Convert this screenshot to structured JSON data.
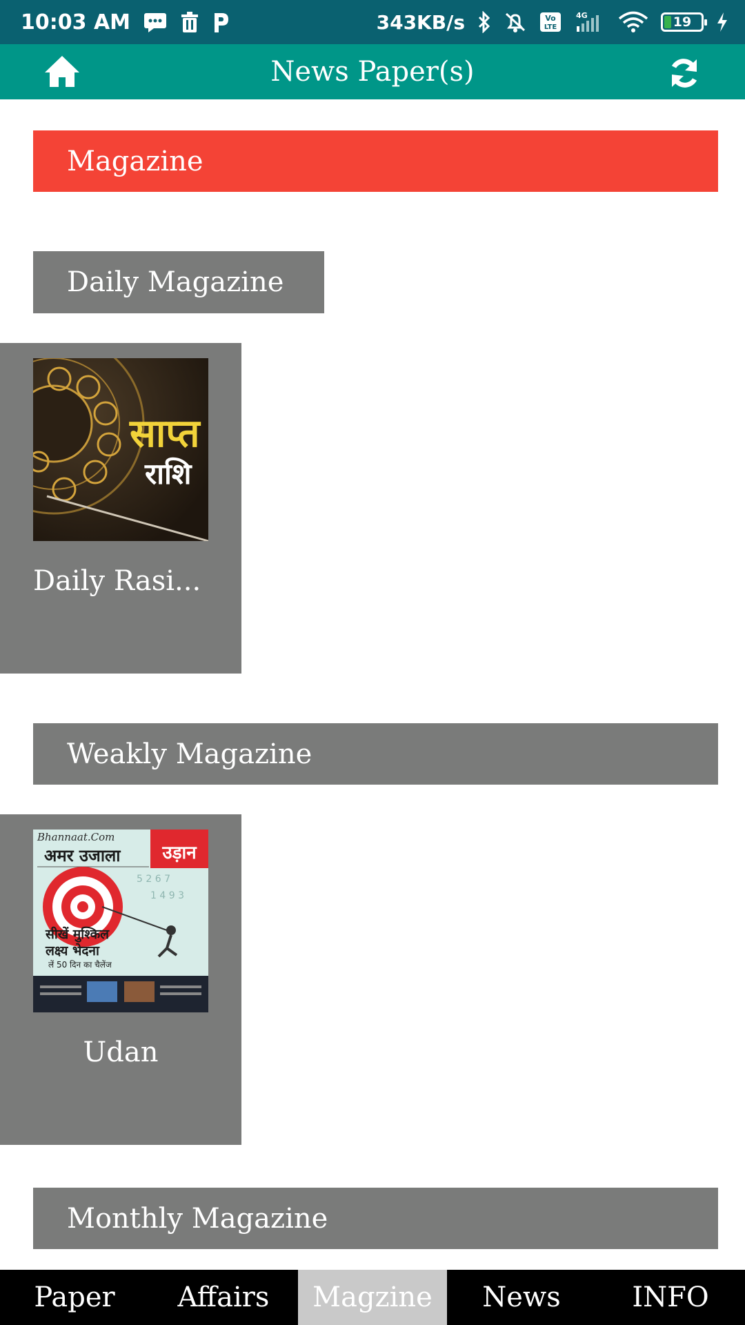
{
  "status_bar": {
    "time": "10:03 AM",
    "speed": "343KB/s",
    "battery": "19",
    "icons": [
      "message-icon",
      "trash-icon",
      "parking-icon",
      "bluetooth-icon",
      "alarm-off-icon",
      "volte-icon",
      "signal-icon",
      "wifi-icon",
      "battery-icon",
      "charging-icon"
    ]
  },
  "app_bar": {
    "title": "News Paper(s)",
    "home_icon": "home-icon",
    "refresh_icon": "refresh-icon",
    "color": "#009688"
  },
  "sections": {
    "main_title": "Magazine",
    "daily": {
      "title": "Daily Magazine",
      "items": [
        {
          "label": "Daily Rasi...",
          "thumb_text_line1": "साप्त",
          "thumb_text_line2": "राशि"
        }
      ]
    },
    "weekly": {
      "title": "Weakly Magazine",
      "items": [
        {
          "label": "Udan",
          "thumb_brand": "Bhannaat.Com",
          "thumb_masthead": "अमर उजाला",
          "thumb_badge": "उड़ान",
          "thumb_line1": "सीखें मुश्किल",
          "thumb_line2": "लक्ष्य भेदना",
          "thumb_line3": "लें 50 दिन का चैलेंज"
        }
      ]
    },
    "monthly": {
      "title": "Monthly Magazine"
    }
  },
  "bottom_nav": {
    "tabs": [
      "Paper",
      "Affairs",
      "Magzine",
      "News",
      "INFO"
    ],
    "active_index": 2
  },
  "colors": {
    "accent_red": "#f44336",
    "section_gray": "#7a7b7a",
    "status_bar": "#0a6170"
  }
}
